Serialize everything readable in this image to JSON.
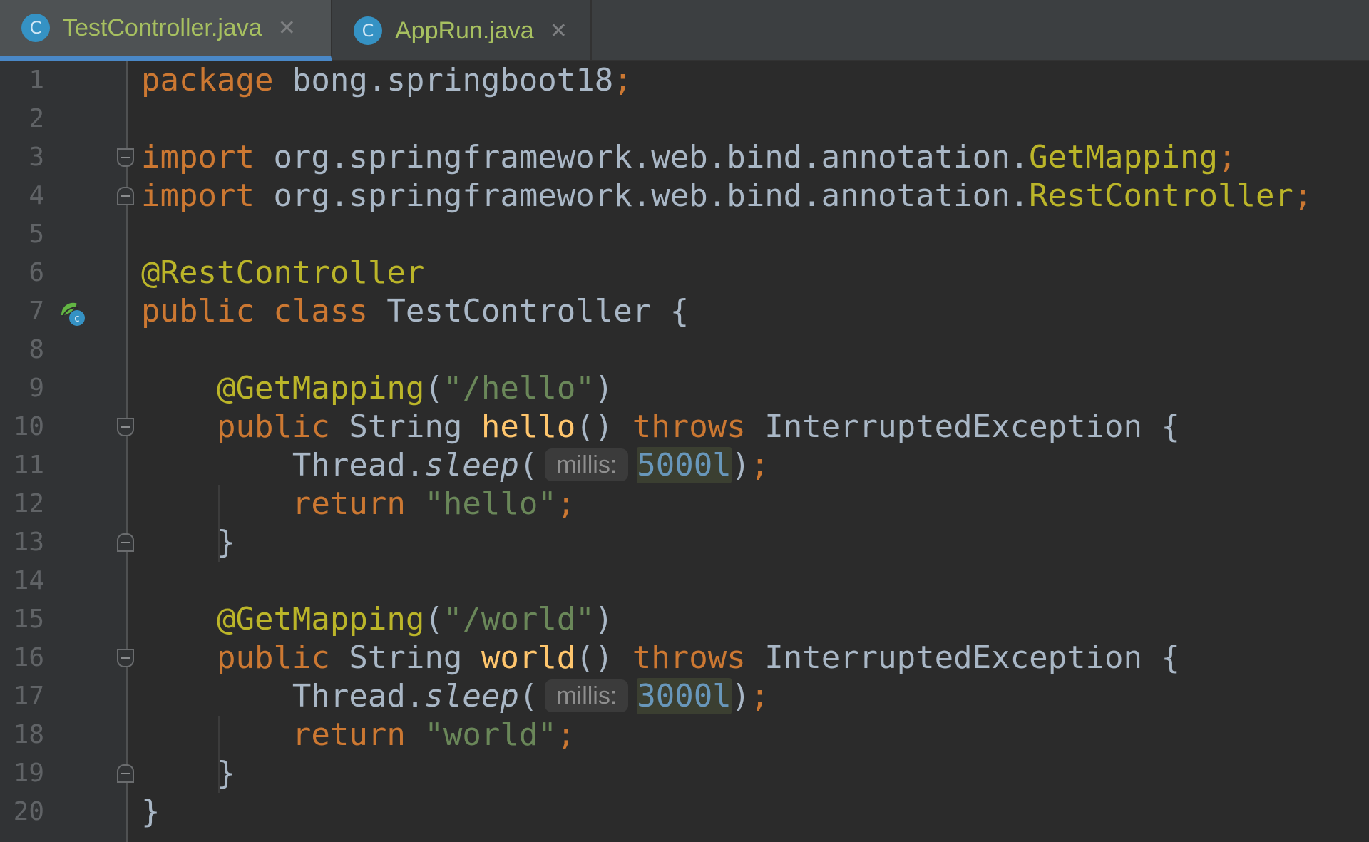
{
  "tabs": [
    {
      "icon": "C",
      "label": "TestController.java",
      "close": "✕",
      "active": true
    },
    {
      "icon": "C",
      "label": "AppRun.java",
      "close": "✕",
      "active": false
    }
  ],
  "line_numbers": [
    "1",
    "2",
    "3",
    "4",
    "5",
    "6",
    "7",
    "8",
    "9",
    "10",
    "11",
    "12",
    "13",
    "14",
    "15",
    "16",
    "17",
    "18",
    "19",
    "20"
  ],
  "code": {
    "l1": {
      "kw": "package",
      "rest": " bong.springboot18",
      "semi": ";"
    },
    "l3": {
      "kw": "import",
      "pkg": " org.springframework.web.bind.annotation.",
      "cls": "GetMapping",
      "semi": ";"
    },
    "l4": {
      "kw": "import",
      "pkg": " org.springframework.web.bind.annotation.",
      "cls": "RestController",
      "semi": ";"
    },
    "l6": {
      "ann": "@RestController"
    },
    "l7": {
      "kw": "public class",
      "rest": " TestController {"
    },
    "l9": {
      "ann": "@GetMapping",
      "open": "(",
      "str": "\"/hello\"",
      "close": ")"
    },
    "l10": {
      "kw1": "public",
      "type": " String ",
      "fn": "hello",
      "paren": "() ",
      "kw2": "throws",
      "rest": " InterruptedException {"
    },
    "l11": {
      "obj": "Thread.",
      "method": "sleep",
      "open": "(",
      "hint": "millis:",
      "num": "5000l",
      "close": ")",
      "semi": ";"
    },
    "l12": {
      "kw": "return",
      "str": " \"hello\"",
      "semi": ";"
    },
    "l13": {
      "brace": "}"
    },
    "l15": {
      "ann": "@GetMapping",
      "open": "(",
      "str": "\"/world\"",
      "close": ")"
    },
    "l16": {
      "kw1": "public",
      "type": " String ",
      "fn": "world",
      "paren": "() ",
      "kw2": "throws",
      "rest": " InterruptedException {"
    },
    "l17": {
      "obj": "Thread.",
      "method": "sleep",
      "open": "(",
      "hint": "millis:",
      "num": "3000l",
      "close": ")",
      "semi": ";"
    },
    "l18": {
      "kw": "return",
      "str": " \"world\"",
      "semi": ";"
    },
    "l19": {
      "brace": "}"
    },
    "l20": {
      "brace": "}"
    }
  },
  "colors": {
    "background": "#2b2b2b",
    "keyword": "#cc7832",
    "annotation": "#bbb529",
    "string": "#6a8759",
    "function": "#ffc66d",
    "number": "#6897bb",
    "text": "#a9b7c6",
    "tab_accent": "#4a88c7"
  },
  "icons": {
    "tab_icon": "java-class-icon",
    "tab_close": "close-icon",
    "gutter_bean": "spring-bean-icon",
    "fold": "fold-marker-icon"
  }
}
